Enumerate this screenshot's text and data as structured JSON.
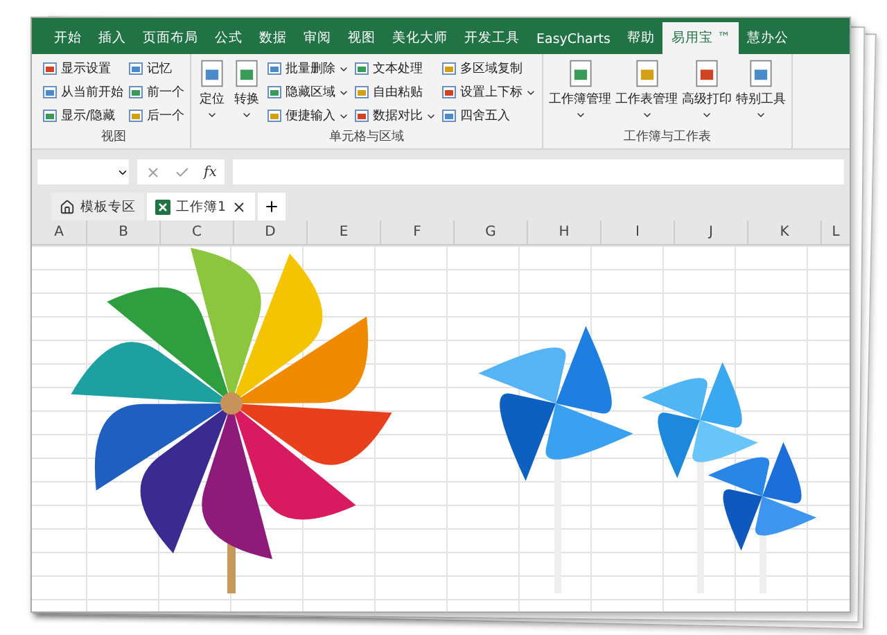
{
  "menu_tabs": [
    {
      "label": "开始",
      "selected": false
    },
    {
      "label": "插入",
      "selected": false
    },
    {
      "label": "页面布局",
      "selected": false
    },
    {
      "label": "公式",
      "selected": false
    },
    {
      "label": "数据",
      "selected": false
    },
    {
      "label": "审阅",
      "selected": false
    },
    {
      "label": "视图",
      "selected": false
    },
    {
      "label": "美化大师",
      "selected": false
    },
    {
      "label": "开发工具",
      "selected": false
    },
    {
      "label": "EasyCharts",
      "selected": false
    },
    {
      "label": "帮助",
      "selected": false
    },
    {
      "label": "易用宝 ™",
      "selected": true
    },
    {
      "label": "慧办公",
      "selected": false
    }
  ],
  "ribbon": {
    "groups": [
      {
        "title": "视图",
        "columns": [
          {
            "kind": "small",
            "items": [
              {
                "label": "显示设置",
                "dropdown": false
              },
              {
                "label": "从当前开始",
                "dropdown": false
              },
              {
                "label": "显示/隐藏",
                "dropdown": false
              }
            ]
          },
          {
            "kind": "small",
            "items": [
              {
                "label": "记忆",
                "dropdown": false
              },
              {
                "label": "前一个",
                "dropdown": false
              },
              {
                "label": "后一个",
                "dropdown": false
              }
            ]
          }
        ]
      },
      {
        "title": "单元格与区域",
        "columns": [
          {
            "kind": "large",
            "items": [
              {
                "label": "定位",
                "dropdown": true
              },
              {
                "label": "转换",
                "dropdown": true
              }
            ]
          },
          {
            "kind": "small",
            "items": [
              {
                "label": "批量删除",
                "dropdown": true
              },
              {
                "label": "隐藏区域",
                "dropdown": true
              },
              {
                "label": "便捷输入",
                "dropdown": true
              }
            ]
          },
          {
            "kind": "small",
            "items": [
              {
                "label": "文本处理",
                "dropdown": false
              },
              {
                "label": "自由粘贴",
                "dropdown": false
              },
              {
                "label": "数据对比",
                "dropdown": true
              }
            ]
          },
          {
            "kind": "small",
            "items": [
              {
                "label": "多区域复制",
                "dropdown": false
              },
              {
                "label": "设置上下标",
                "dropdown": true
              },
              {
                "label": "四舍五入",
                "dropdown": false
              }
            ]
          }
        ]
      },
      {
        "title": "工作簿与工作表",
        "columns": [
          {
            "kind": "large",
            "items": [
              {
                "label": "工作簿管理",
                "dropdown": true
              },
              {
                "label": "工作表管理",
                "dropdown": true
              },
              {
                "label": "高级打印",
                "dropdown": true
              },
              {
                "label": "特别工具",
                "dropdown": true
              }
            ]
          }
        ]
      }
    ]
  },
  "formula_bar": {
    "function_label": "fx"
  },
  "sheet_tabs": [
    {
      "label": "模板专区",
      "selected": false,
      "kind": "home"
    },
    {
      "label": "工作簿1",
      "selected": true,
      "kind": "workbook"
    }
  ],
  "columns": [
    "A",
    "B",
    "C",
    "D",
    "E",
    "F",
    "G",
    "H",
    "I",
    "J",
    "K",
    "L"
  ]
}
